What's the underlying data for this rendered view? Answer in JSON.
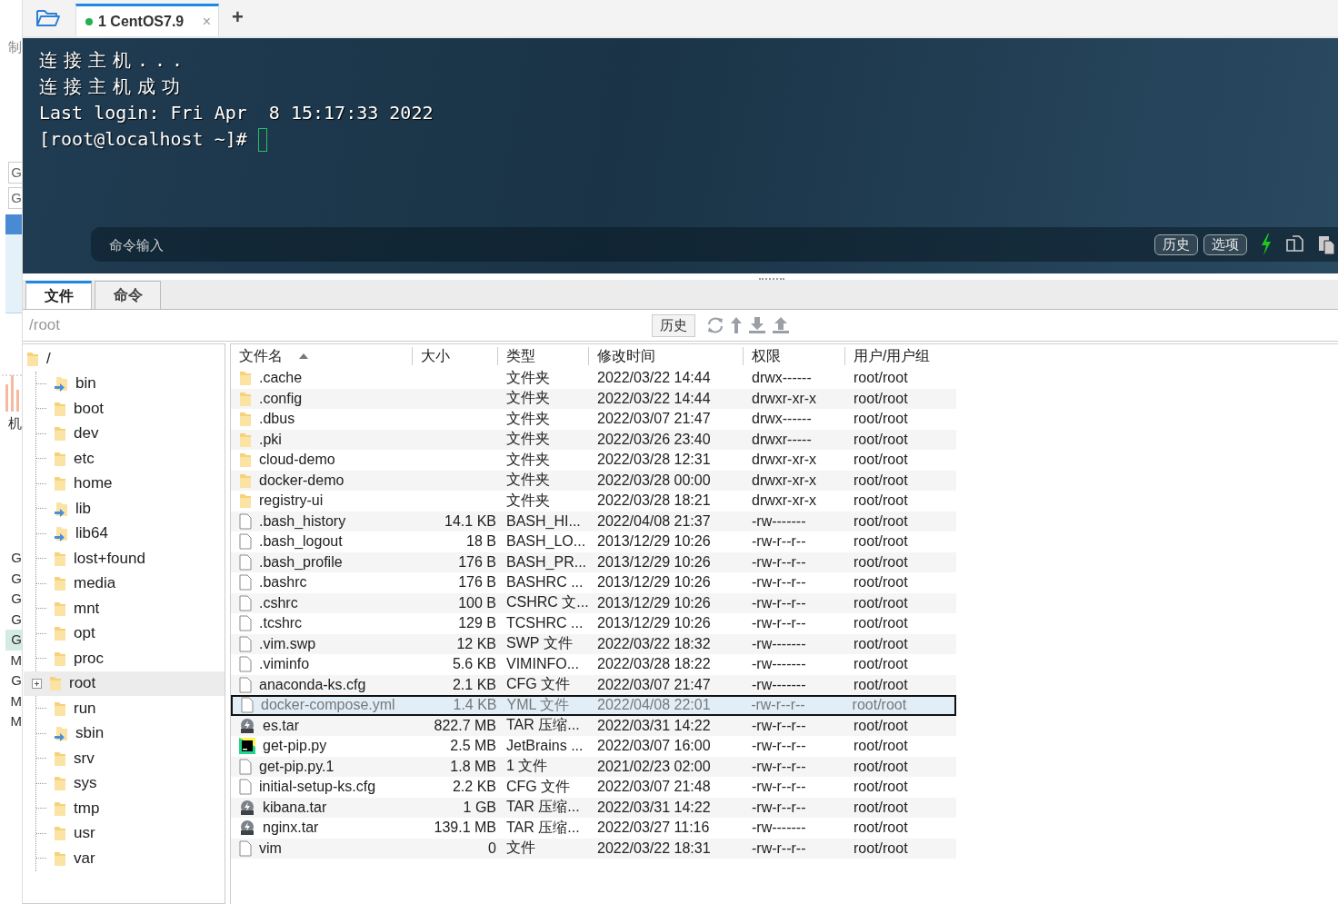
{
  "left_strip": {
    "texts": [
      "制",
      "G",
      "G",
      "机"
    ],
    "list": [
      {
        "text": "G",
        "selected": false
      },
      {
        "text": "G",
        "selected": false
      },
      {
        "text": "G",
        "selected": false
      },
      {
        "text": "G",
        "selected": false
      },
      {
        "text": "G",
        "selected": true
      },
      {
        "text": "M",
        "selected": false
      },
      {
        "text": "G",
        "selected": false
      },
      {
        "text": "M",
        "selected": false
      },
      {
        "text": "M",
        "selected": false
      }
    ]
  },
  "session_tabs": [
    {
      "label": "1 CentOS7.9",
      "selected": true,
      "connected": true,
      "close": "×"
    }
  ],
  "new_tab": "+",
  "terminal": {
    "lines": [
      "连接主机...",
      "连接主机成功",
      "Last login: Fri Apr  8 15:17:33 2022"
    ],
    "prompt": "[root@localhost ~]#"
  },
  "command_bar": {
    "placeholder": "命令输入",
    "buttons": [
      "历史",
      "选项"
    ]
  },
  "panel_tabs": [
    {
      "label": "文件",
      "selected": true
    },
    {
      "label": "命令",
      "selected": false
    }
  ],
  "path": "/root",
  "history_button": "历史",
  "tree": {
    "label": "/",
    "children": [
      {
        "label": "bin",
        "kind": "link",
        "selected": false,
        "expandable": false
      },
      {
        "label": "boot",
        "kind": "folder",
        "selected": false,
        "expandable": false
      },
      {
        "label": "dev",
        "kind": "folder",
        "selected": false,
        "expandable": false
      },
      {
        "label": "etc",
        "kind": "folder",
        "selected": false,
        "expandable": false
      },
      {
        "label": "home",
        "kind": "folder",
        "selected": false,
        "expandable": false
      },
      {
        "label": "lib",
        "kind": "link",
        "selected": false,
        "expandable": false
      },
      {
        "label": "lib64",
        "kind": "link",
        "selected": false,
        "expandable": false
      },
      {
        "label": "lost+found",
        "kind": "folder",
        "selected": false,
        "expandable": false
      },
      {
        "label": "media",
        "kind": "folder",
        "selected": false,
        "expandable": false
      },
      {
        "label": "mnt",
        "kind": "folder",
        "selected": false,
        "expandable": false
      },
      {
        "label": "opt",
        "kind": "folder",
        "selected": false,
        "expandable": false
      },
      {
        "label": "proc",
        "kind": "folder",
        "selected": false,
        "expandable": false
      },
      {
        "label": "root",
        "kind": "folder",
        "selected": true,
        "expandable": true
      },
      {
        "label": "run",
        "kind": "folder",
        "selected": false,
        "expandable": false
      },
      {
        "label": "sbin",
        "kind": "link",
        "selected": false,
        "expandable": false
      },
      {
        "label": "srv",
        "kind": "folder",
        "selected": false,
        "expandable": false
      },
      {
        "label": "sys",
        "kind": "folder",
        "selected": false,
        "expandable": false
      },
      {
        "label": "tmp",
        "kind": "folder",
        "selected": false,
        "expandable": false
      },
      {
        "label": "usr",
        "kind": "folder",
        "selected": false,
        "expandable": false
      },
      {
        "label": "var",
        "kind": "folder",
        "selected": false,
        "expandable": false
      }
    ]
  },
  "table": {
    "columns": [
      {
        "label": "文件名",
        "sorted": true
      },
      {
        "label": "大小",
        "sorted": false
      },
      {
        "label": "类型",
        "sorted": false
      },
      {
        "label": "修改时间",
        "sorted": false
      },
      {
        "label": "权限",
        "sorted": false
      },
      {
        "label": "用户/用户组",
        "sorted": false
      }
    ],
    "rows": [
      {
        "kind": "folder",
        "name": ".cache",
        "size": "",
        "type": "文件夹",
        "modified": "2022/03/22 14:44",
        "permissions": "drwx------",
        "owner": "root/root",
        "selected": false
      },
      {
        "kind": "folder",
        "name": ".config",
        "size": "",
        "type": "文件夹",
        "modified": "2022/03/22 14:44",
        "permissions": "drwxr-xr-x",
        "owner": "root/root",
        "selected": false
      },
      {
        "kind": "folder",
        "name": ".dbus",
        "size": "",
        "type": "文件夹",
        "modified": "2022/03/07 21:47",
        "permissions": "drwx------",
        "owner": "root/root",
        "selected": false
      },
      {
        "kind": "folder",
        "name": ".pki",
        "size": "",
        "type": "文件夹",
        "modified": "2022/03/26 23:40",
        "permissions": "drwxr-----",
        "owner": "root/root",
        "selected": false
      },
      {
        "kind": "folder",
        "name": "cloud-demo",
        "size": "",
        "type": "文件夹",
        "modified": "2022/03/28 12:31",
        "permissions": "drwxr-xr-x",
        "owner": "root/root",
        "selected": false
      },
      {
        "kind": "folder",
        "name": "docker-demo",
        "size": "",
        "type": "文件夹",
        "modified": "2022/03/28 00:00",
        "permissions": "drwxr-xr-x",
        "owner": "root/root",
        "selected": false
      },
      {
        "kind": "folder",
        "name": "registry-ui",
        "size": "",
        "type": "文件夹",
        "modified": "2022/03/28 18:21",
        "permissions": "drwxr-xr-x",
        "owner": "root/root",
        "selected": false
      },
      {
        "kind": "file",
        "name": ".bash_history",
        "size": "14.1 KB",
        "type": "BASH_HI...",
        "modified": "2022/04/08 21:37",
        "permissions": "-rw-------",
        "owner": "root/root",
        "selected": false
      },
      {
        "kind": "file",
        "name": ".bash_logout",
        "size": "18 B",
        "type": "BASH_LO...",
        "modified": "2013/12/29 10:26",
        "permissions": "-rw-r--r--",
        "owner": "root/root",
        "selected": false
      },
      {
        "kind": "file",
        "name": ".bash_profile",
        "size": "176 B",
        "type": "BASH_PR...",
        "modified": "2013/12/29 10:26",
        "permissions": "-rw-r--r--",
        "owner": "root/root",
        "selected": false
      },
      {
        "kind": "file",
        "name": ".bashrc",
        "size": "176 B",
        "type": "BASHRC ...",
        "modified": "2013/12/29 10:26",
        "permissions": "-rw-r--r--",
        "owner": "root/root",
        "selected": false
      },
      {
        "kind": "file",
        "name": ".cshrc",
        "size": "100 B",
        "type": "CSHRC 文...",
        "modified": "2013/12/29 10:26",
        "permissions": "-rw-r--r--",
        "owner": "root/root",
        "selected": false
      },
      {
        "kind": "file",
        "name": ".tcshrc",
        "size": "129 B",
        "type": "TCSHRC ...",
        "modified": "2013/12/29 10:26",
        "permissions": "-rw-r--r--",
        "owner": "root/root",
        "selected": false
      },
      {
        "kind": "file",
        "name": ".vim.swp",
        "size": "12 KB",
        "type": "SWP 文件",
        "modified": "2022/03/22 18:32",
        "permissions": "-rw-------",
        "owner": "root/root",
        "selected": false
      },
      {
        "kind": "file",
        "name": ".viminfo",
        "size": "5.6 KB",
        "type": "VIMINFO...",
        "modified": "2022/03/28 18:22",
        "permissions": "-rw-------",
        "owner": "root/root",
        "selected": false
      },
      {
        "kind": "file",
        "name": "anaconda-ks.cfg",
        "size": "2.1 KB",
        "type": "CFG 文件",
        "modified": "2022/03/07 21:47",
        "permissions": "-rw-------",
        "owner": "root/root",
        "selected": false
      },
      {
        "kind": "file",
        "name": "docker-compose.yml",
        "size": "1.4 KB",
        "type": "YML 文件",
        "modified": "2022/04/08 22:01",
        "permissions": "-rw-r--r--",
        "owner": "root/root",
        "selected": true
      },
      {
        "kind": "archive",
        "name": "es.tar",
        "size": "822.7 MB",
        "type": "TAR 压缩...",
        "modified": "2022/03/31 14:22",
        "permissions": "-rw-r--r--",
        "owner": "root/root",
        "selected": false
      },
      {
        "kind": "python",
        "name": "get-pip.py",
        "size": "2.5 MB",
        "type": "JetBrains ...",
        "modified": "2022/03/07 16:00",
        "permissions": "-rw-r--r--",
        "owner": "root/root",
        "selected": false
      },
      {
        "kind": "file",
        "name": "get-pip.py.1",
        "size": "1.8 MB",
        "type": "1 文件",
        "modified": "2021/02/23 02:00",
        "permissions": "-rw-r--r--",
        "owner": "root/root",
        "selected": false
      },
      {
        "kind": "file",
        "name": "initial-setup-ks.cfg",
        "size": "2.2 KB",
        "type": "CFG 文件",
        "modified": "2022/03/07 21:48",
        "permissions": "-rw-r--r--",
        "owner": "root/root",
        "selected": false
      },
      {
        "kind": "archive",
        "name": "kibana.tar",
        "size": "1 GB",
        "type": "TAR 压缩...",
        "modified": "2022/03/31 14:22",
        "permissions": "-rw-r--r--",
        "owner": "root/root",
        "selected": false
      },
      {
        "kind": "archive",
        "name": "nginx.tar",
        "size": "139.1 MB",
        "type": "TAR 压缩...",
        "modified": "2022/03/27 11:16",
        "permissions": "-rw-------",
        "owner": "root/root",
        "selected": false
      },
      {
        "kind": "file",
        "name": "vim",
        "size": "0",
        "type": "文件",
        "modified": "2022/03/22 18:31",
        "permissions": "-rw-r--r--",
        "owner": "root/root",
        "selected": false
      }
    ]
  }
}
